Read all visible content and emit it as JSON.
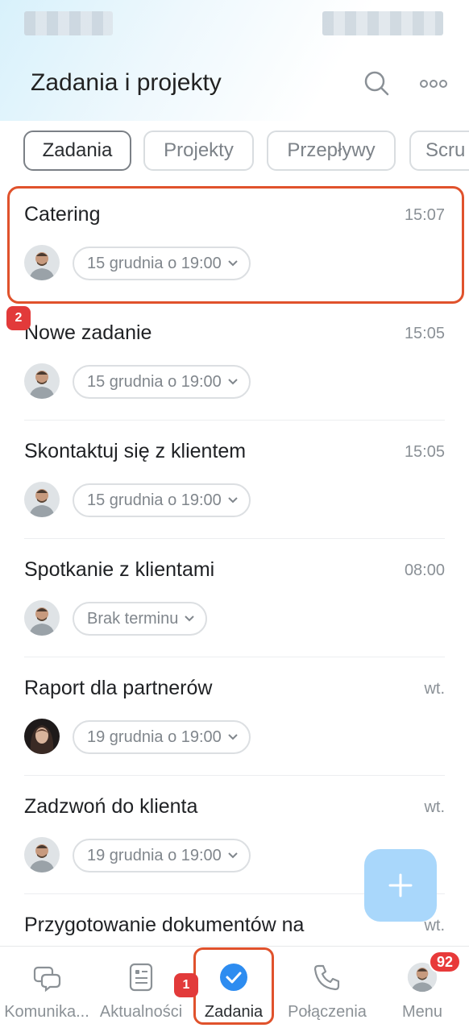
{
  "header": {
    "title": "Zadania i projekty"
  },
  "tabs": [
    {
      "label": "Zadania",
      "active": true
    },
    {
      "label": "Projekty",
      "active": false
    },
    {
      "label": "Przepływy",
      "active": false
    },
    {
      "label": "Scru",
      "active": false
    }
  ],
  "tasks": [
    {
      "title": "Catering",
      "time": "15:07",
      "deadline": "15 grudnia o 19:00",
      "avatar": "avatar-man"
    },
    {
      "title": "Nowe zadanie",
      "time": "15:05",
      "deadline": "15 grudnia o 19:00",
      "avatar": "avatar-man"
    },
    {
      "title": "Skontaktuj się z klientem",
      "time": "15:05",
      "deadline": "15 grudnia o 19:00",
      "avatar": "avatar-man"
    },
    {
      "title": "Spotkanie z klientami",
      "time": "08:00",
      "deadline": "Brak terminu",
      "avatar": "avatar-man"
    },
    {
      "title": "Raport dla partnerów",
      "time": "wt.",
      "deadline": "19 grudnia o 19:00",
      "avatar": "avatar-woman"
    },
    {
      "title": "Zadzwoń do klienta",
      "time": "wt.",
      "deadline": "19 grudnia o 19:00",
      "avatar": "avatar-man"
    },
    {
      "title": "Przygotowanie dokumentów na",
      "time": "wt.",
      "deadline": "",
      "avatar": ""
    }
  ],
  "markers": {
    "task_marker": "2",
    "nav_marker": "1"
  },
  "nav": [
    {
      "label": "Komunika...",
      "icon": "chat-icon"
    },
    {
      "label": "Aktualności",
      "icon": "news-icon"
    },
    {
      "label": "Zadania",
      "icon": "check-circle-icon",
      "active": true
    },
    {
      "label": "Połączenia",
      "icon": "phone-icon"
    },
    {
      "label": "Menu",
      "icon": "avatar"
    }
  ],
  "menu_badge": "92",
  "colors": {
    "accent": "#2d8cf0",
    "highlight": "#e0522c",
    "badge": "#e83a3a",
    "fab": "#a9d7fb"
  }
}
